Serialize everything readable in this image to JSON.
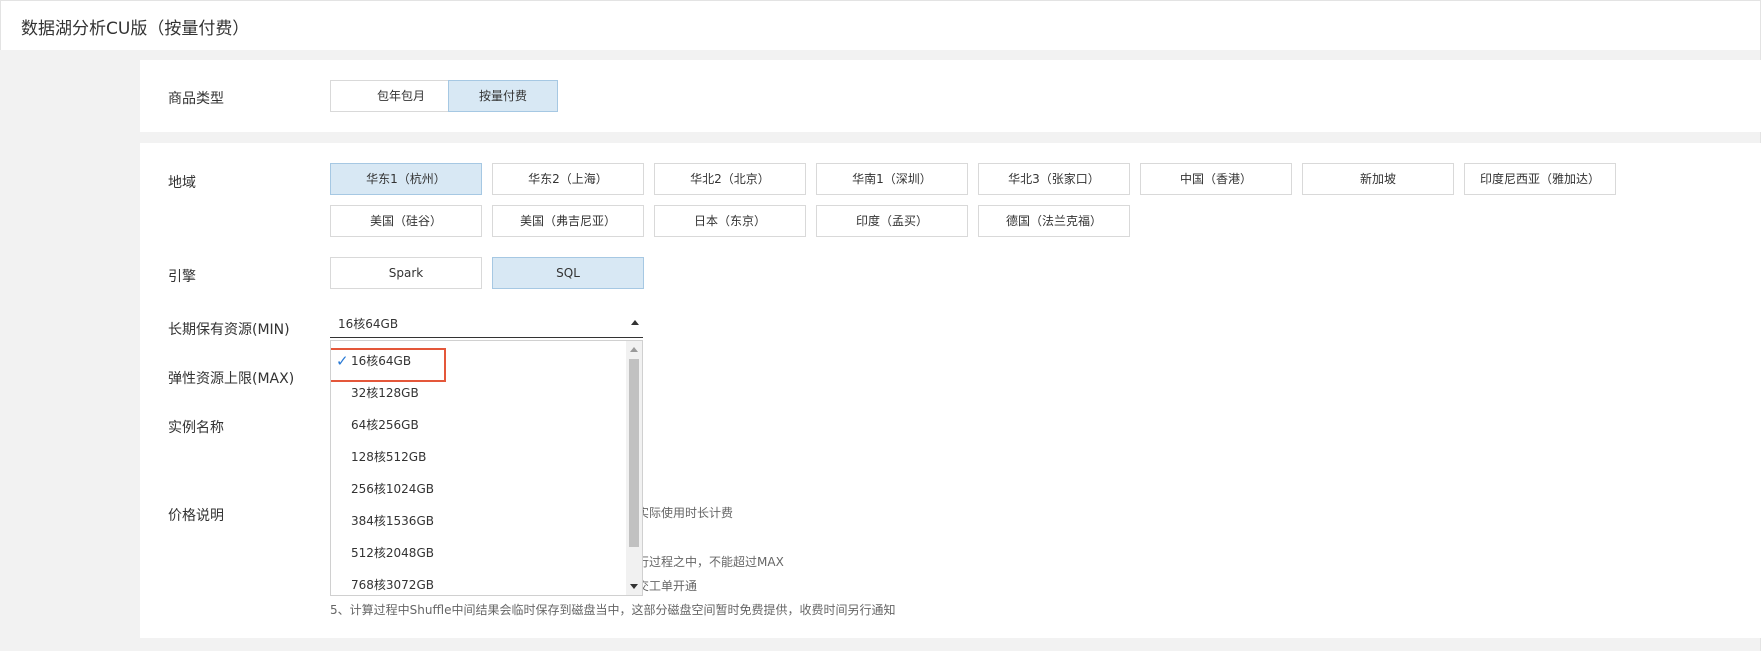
{
  "header": {
    "title": "数据湖分析CU版（按量付费）"
  },
  "product_type": {
    "label": "商品类型",
    "options": [
      {
        "label": "包年包月",
        "selected": false
      },
      {
        "label": "按量付费",
        "selected": true
      }
    ]
  },
  "region": {
    "label": "地域",
    "options": [
      {
        "label": "华东1（杭州）",
        "selected": true
      },
      {
        "label": "华东2（上海）",
        "selected": false
      },
      {
        "label": "华北2（北京）",
        "selected": false
      },
      {
        "label": "华南1（深圳）",
        "selected": false
      },
      {
        "label": "华北3（张家口）",
        "selected": false
      },
      {
        "label": "中国（香港）",
        "selected": false
      },
      {
        "label": "新加坡",
        "selected": false
      },
      {
        "label": "印度尼西亚（雅加达）",
        "selected": false
      },
      {
        "label": "美国（硅谷）",
        "selected": false
      },
      {
        "label": "美国（弗吉尼亚）",
        "selected": false
      },
      {
        "label": "日本（东京）",
        "selected": false
      },
      {
        "label": "印度（孟买）",
        "selected": false
      },
      {
        "label": "德国（法兰克福）",
        "selected": false
      }
    ]
  },
  "engine": {
    "label": "引擎",
    "options": [
      {
        "label": "Spark",
        "selected": false
      },
      {
        "label": "SQL",
        "selected": true
      }
    ]
  },
  "min_resource": {
    "label": "长期保有资源(MIN)",
    "value": "16核64GB",
    "dropdown_options": [
      {
        "label": "16核64GB",
        "selected": true
      },
      {
        "label": "32核128GB",
        "selected": false
      },
      {
        "label": "64核256GB",
        "selected": false
      },
      {
        "label": "128核512GB",
        "selected": false
      },
      {
        "label": "256核1024GB",
        "selected": false
      },
      {
        "label": "384核1536GB",
        "selected": false
      },
      {
        "label": "512核2048GB",
        "selected": false
      },
      {
        "label": "768核3072GB",
        "selected": false
      }
    ]
  },
  "max_resource": {
    "label": "弹性资源上限(MAX)"
  },
  "instance_name": {
    "label": "实例名称"
  },
  "price": {
    "label": "价格说明",
    "notes_visible": [
      "实际使用时长计费",
      "行过程之中，不能超过MAX",
      "交工单开通",
      "5、计算过程中Shuffle中间结果会临时保存到磁盘当中，这部分磁盘空间暂时免费提供，收费时间另行通知"
    ]
  },
  "colors": {
    "selected_bg": "#d8e8f4",
    "check": "#2a7ad5",
    "highlight_border": "#e4573a"
  }
}
